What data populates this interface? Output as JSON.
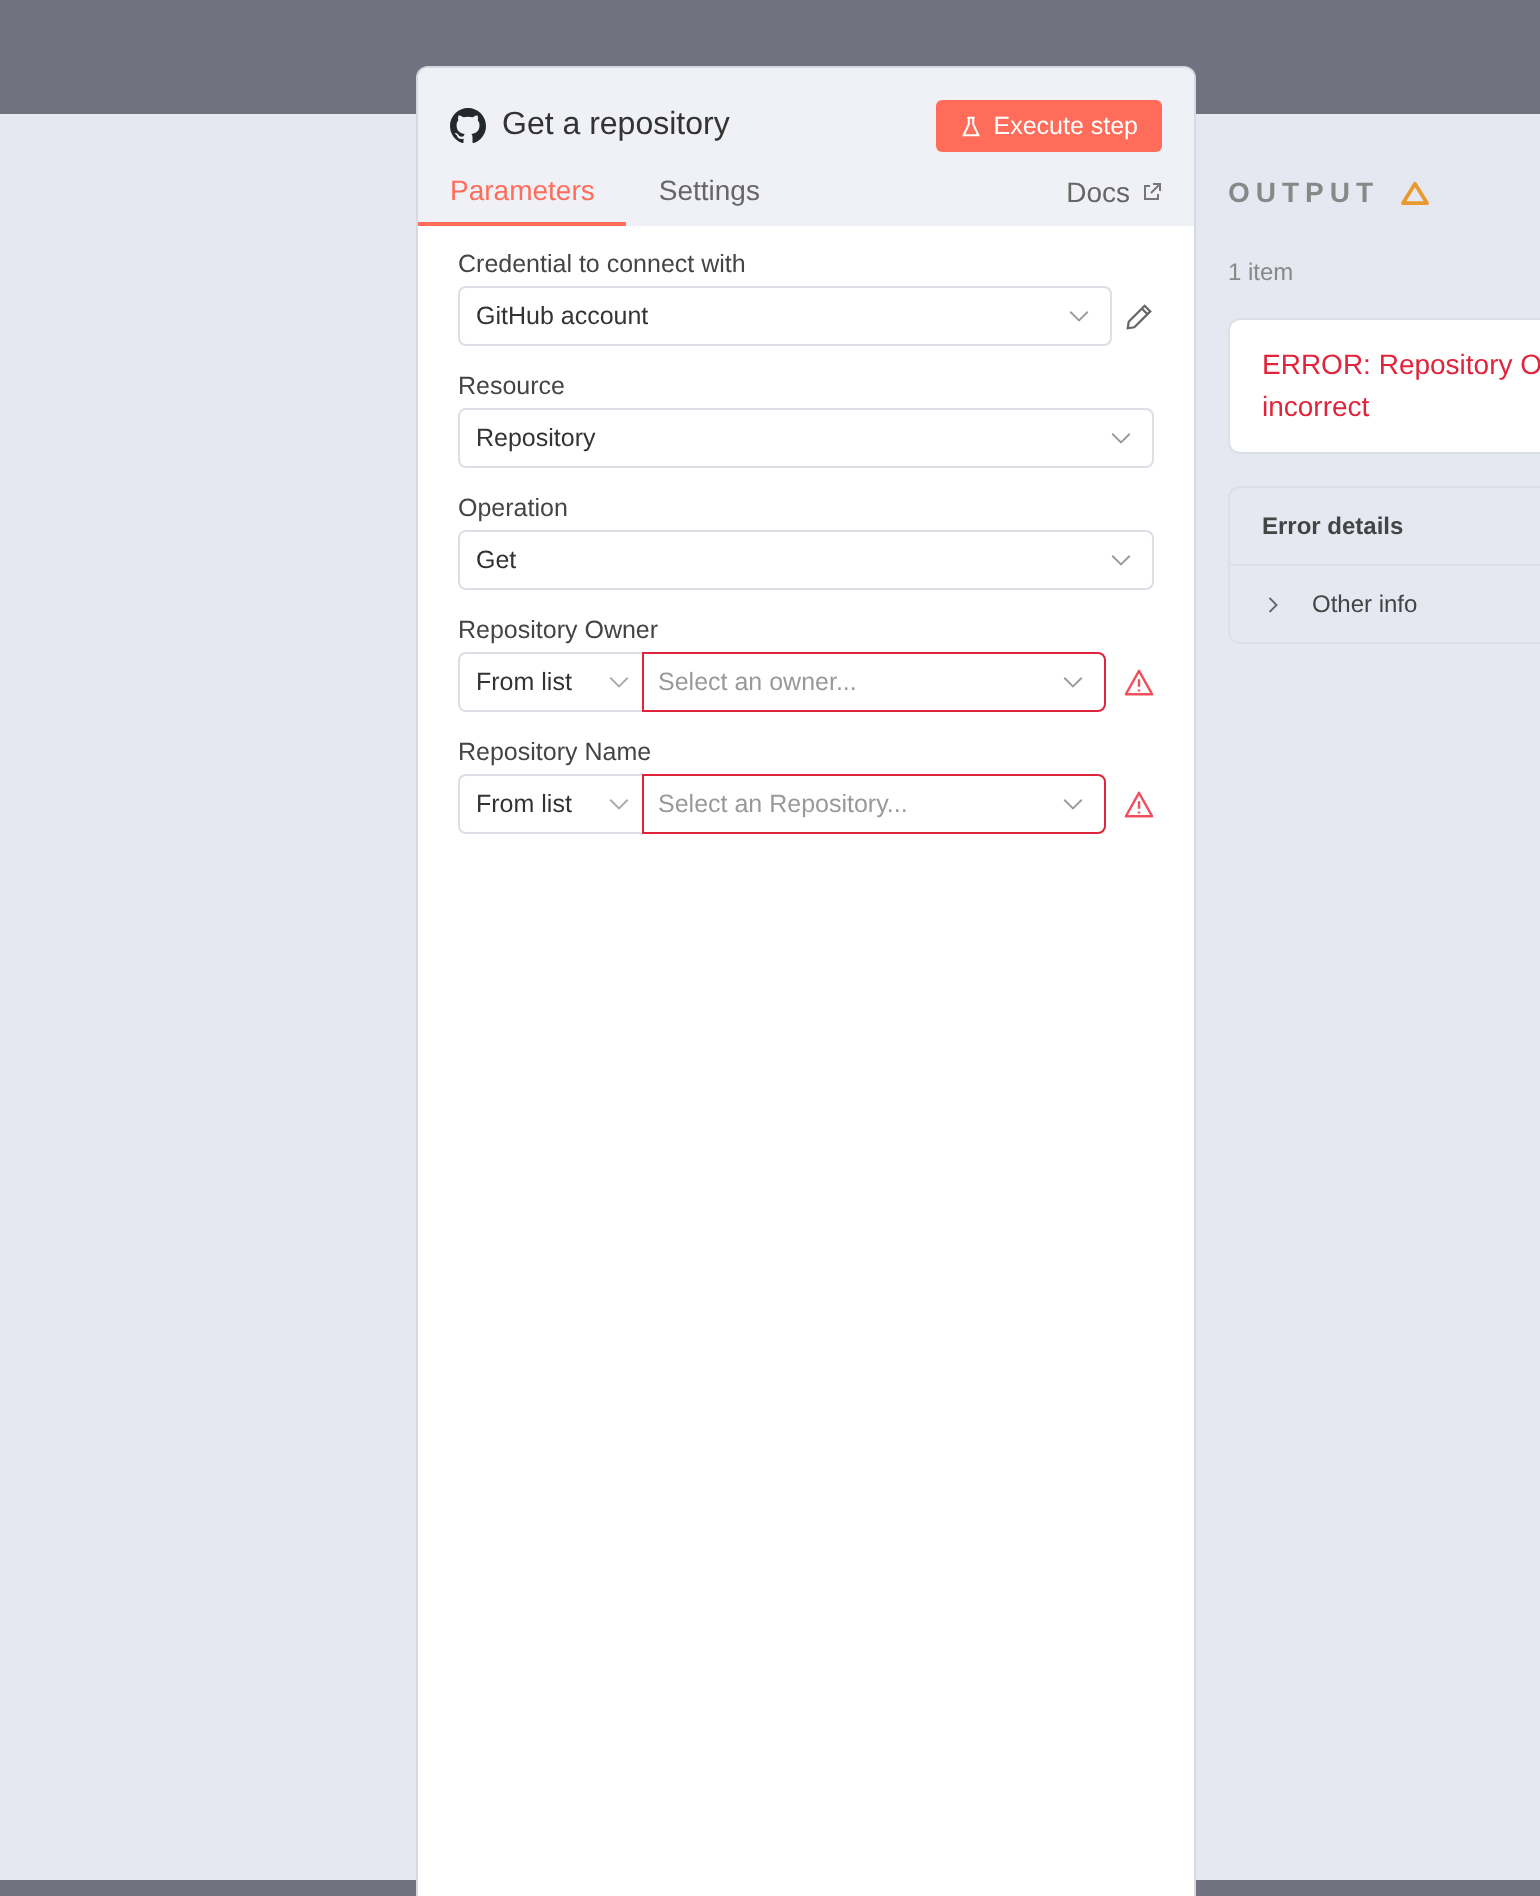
{
  "panel": {
    "title": "Get a repository",
    "execute_button": "Execute step",
    "tabs": [
      {
        "label": "Parameters",
        "selected": true
      },
      {
        "label": "Settings",
        "selected": false
      }
    ],
    "docs_link": "Docs",
    "fields": [
      {
        "kind": "credential",
        "label": "Credential to connect with",
        "value": "GitHub account"
      },
      {
        "kind": "select",
        "label": "Resource",
        "value": "Repository"
      },
      {
        "kind": "select",
        "label": "Operation",
        "value": "Get"
      },
      {
        "kind": "locator",
        "label": "Repository Owner",
        "mode": "From list",
        "placeholder": "Select an owner...",
        "error": true
      },
      {
        "kind": "locator",
        "label": "Repository Name",
        "mode": "From list",
        "placeholder": "Select an Repository...",
        "error": true
      }
    ]
  },
  "output": {
    "title": "OUTPUT",
    "count": "1 item",
    "error_lines": [
      "ERROR: Repository O",
      "incorrect"
    ],
    "details_title": "Error details",
    "details_item": {
      "label": "Other info",
      "expanded": false
    }
  }
}
